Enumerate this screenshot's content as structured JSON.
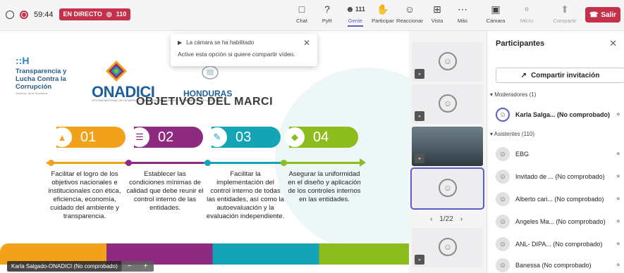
{
  "topbar": {
    "timer": "59:44",
    "live_label": "EN DIRECTO",
    "viewers": "110",
    "buttons": [
      {
        "label": "Chat",
        "icon": "chat-icon"
      },
      {
        "label": "PyR",
        "icon": "qa-icon"
      },
      {
        "label": "Gente",
        "count": "111",
        "icon": "people-icon"
      },
      {
        "label": "Participar",
        "icon": "raise-hand-icon"
      },
      {
        "label": "Reaccionar",
        "icon": "smile-icon"
      },
      {
        "label": "Vista",
        "icon": "grid-icon"
      },
      {
        "label": "Más",
        "icon": "more-icon"
      },
      {
        "label": "Cámara",
        "icon": "camera-off-icon"
      },
      {
        "label": "Micro",
        "icon": "mic-off-icon"
      },
      {
        "label": "Compartir",
        "icon": "share-icon"
      }
    ],
    "leave_label": "Salir"
  },
  "notification": {
    "title": "La cámara se ha habilitado",
    "body": "Active esta opción si quiere compartir vídeo."
  },
  "slide": {
    "org_lines": [
      "Transparencia y",
      "Lucha Contra la",
      "Corrupción"
    ],
    "org_sub": "Gobierno de la República",
    "brand": "ONADICI",
    "brand_sub": "OFICINA NACIONAL DE DESARROLLO INTEGRAL DEL CONTROL INTERNO",
    "country": "HONDURAS",
    "country_sub": "GOBIERNO DE LA REPÚBLICA",
    "title": "OBJETIVOS DEL MARCI",
    "items": [
      {
        "num": "01",
        "color": "#f2a21a",
        "text": "Facilitar el logro de los objetivos nacionales e institucionales con ética, eficiencia, economía, cuidado del ambiente y transparencia."
      },
      {
        "num": "02",
        "color": "#8e2a7f",
        "text": "Establecer las condiciones mínimas de calidad que debe reunir el control interno de las entidades."
      },
      {
        "num": "03",
        "color": "#15a4b5",
        "text": "Facilitar la implementación del control interno de todas las entidades, así como la autoevaluación y la evaluación independiente."
      },
      {
        "num": "04",
        "color": "#8cbc1e",
        "text": "Asegurar la uniformidad en el diseño y aplicación de los controles internos en las entidades."
      }
    ]
  },
  "presenter_name": "Karla Salgado-ONADICI (No comprobado)",
  "gallery": {
    "page": "1/22"
  },
  "panel": {
    "title": "Participantes",
    "share_invite": "Compartir invitación",
    "moderators_header": "Moderadores (1)",
    "attendees_header": "Asistentes (110)",
    "moderators": [
      {
        "name": "Karla Salga... (No comprobado)"
      }
    ],
    "attendees": [
      {
        "name": "EBG"
      },
      {
        "name": "Invitado de ... (No comprobado)"
      },
      {
        "name": "Alberto cari... (No comprobado)"
      },
      {
        "name": "Angeles Ma... (No comprobado)"
      },
      {
        "name": "ANL- DIPA... (No comprobado)"
      },
      {
        "name": "Banessa (No comprobado)"
      }
    ]
  }
}
